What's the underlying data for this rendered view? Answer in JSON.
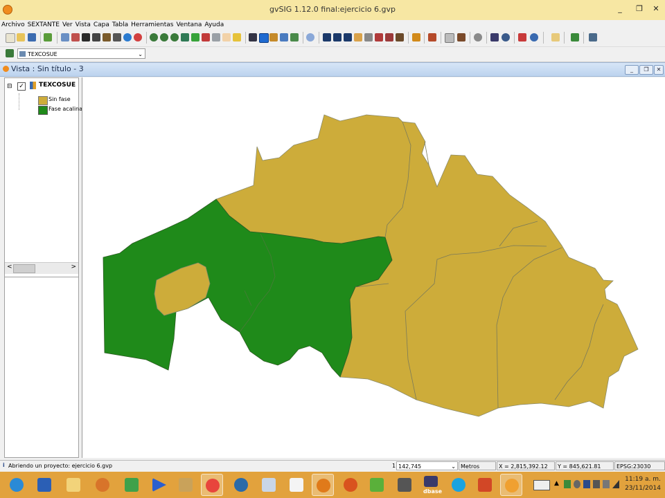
{
  "window": {
    "title": "gvSIG 1.12.0 final:ejercicio 6.gvp",
    "minimize_glyph": "_",
    "restore_glyph": "❐",
    "close_glyph": "✕"
  },
  "menu": [
    "Archivo",
    "SEXTANTE",
    "Ver",
    "Vista",
    "Capa",
    "Tabla",
    "Herramientas",
    "Ventana",
    "Ayuda"
  ],
  "layer_selector": {
    "value": "TEXCOSUE",
    "arrow": "⌄"
  },
  "view": {
    "title": "Vista : Sin título - 3"
  },
  "toc": {
    "layer_name": "TEXCOSUE",
    "collapse_glyph": "⊟",
    "check_glyph": "✓",
    "legend": [
      {
        "label": "Sin fase",
        "color": "#cdac3a"
      },
      {
        "label": "Fase acalina",
        "color": "#1f8a1a"
      }
    ],
    "scroll_left": "<",
    "scroll_right": ">"
  },
  "status": {
    "message": "Abriendo un proyecto: ejercicio 6.gvp",
    "scale_prefix": "1:",
    "scale": "142,745",
    "units": "Metros",
    "x": "X = 2,815,392.12",
    "y": "Y = 845,621.81",
    "epsg": "EPSG:23030"
  },
  "clock": {
    "time": "11:19 a. m.",
    "date": "23/11/2014"
  },
  "taskbar_labels": {
    "dbase": "dbase"
  },
  "colors": {
    "sin_fase": "#cdac3a",
    "fase_acalina": "#1f8a1a",
    "taskbar": "#e2a23d",
    "titlebar": "#f7e7a3"
  }
}
